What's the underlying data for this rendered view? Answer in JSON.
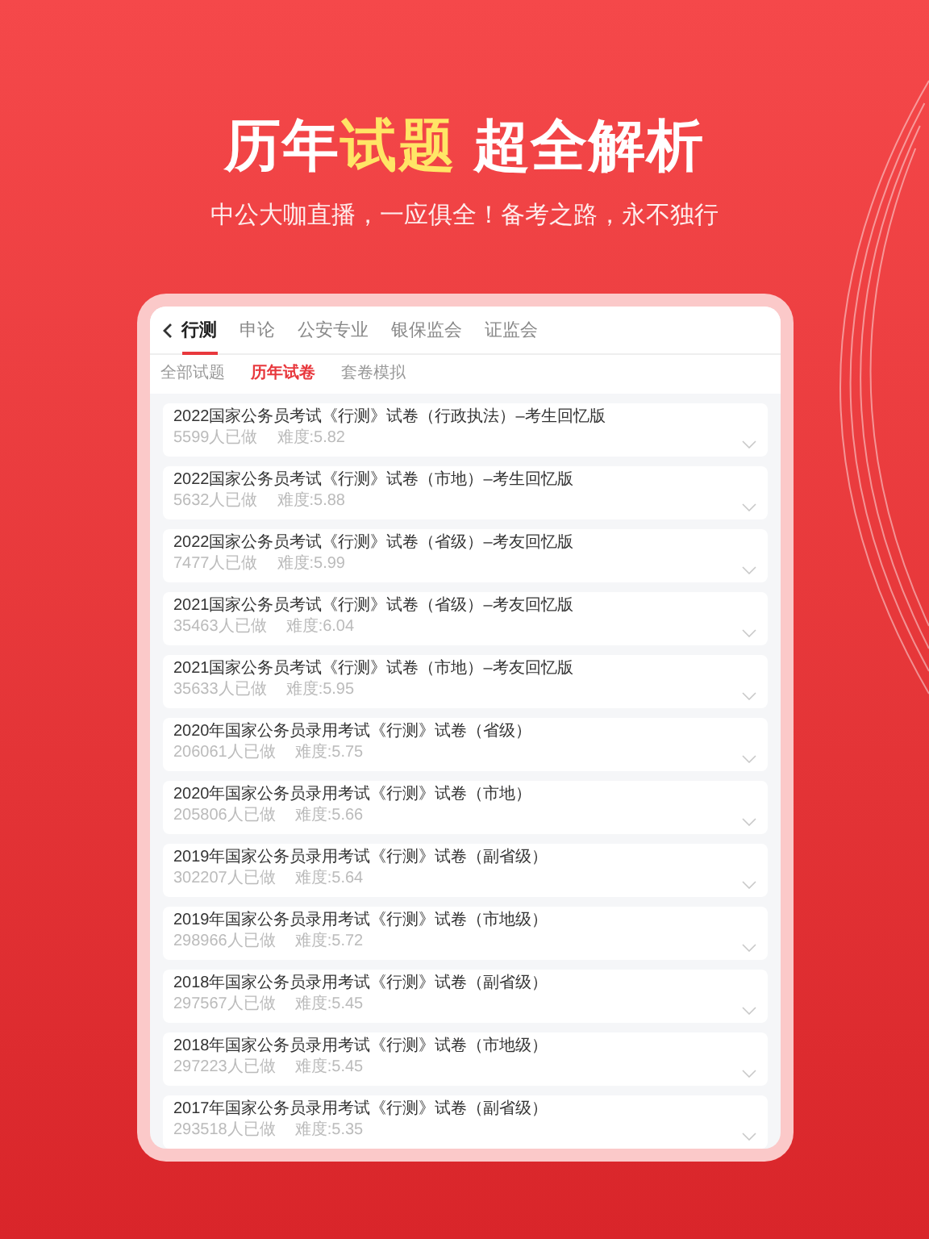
{
  "headline": [
    {
      "text": "历年",
      "highlight": false
    },
    {
      "text": "试题",
      "highlight": true
    },
    {
      "text": " 超全解析",
      "highlight": false
    }
  ],
  "subtitle": "中公大咖直播，一应俱全！备考之路，永不独行",
  "tabs": [
    {
      "label": "行测",
      "selected": true
    },
    {
      "label": "申论",
      "selected": false
    },
    {
      "label": "公安专业",
      "selected": false
    },
    {
      "label": "银保监会",
      "selected": false
    },
    {
      "label": "证监会",
      "selected": false
    }
  ],
  "subtabs": [
    {
      "label": "全部试题",
      "selected": false
    },
    {
      "label": "历年试卷",
      "selected": true
    },
    {
      "label": "套卷模拟",
      "selected": false
    }
  ],
  "papers": [
    {
      "title": "2022国家公务员考试《行测》试卷（行政执法）–考生回忆版",
      "done": "5599人已做",
      "difficulty": "难度:5.82"
    },
    {
      "title": "2022国家公务员考试《行测》试卷（市地）–考生回忆版",
      "done": "5632人已做",
      "difficulty": "难度:5.88"
    },
    {
      "title": "2022国家公务员考试《行测》试卷（省级）–考友回忆版",
      "done": "7477人已做",
      "difficulty": "难度:5.99"
    },
    {
      "title": "2021国家公务员考试《行测》试卷（省级）–考友回忆版",
      "done": "35463人已做",
      "difficulty": "难度:6.04"
    },
    {
      "title": "2021国家公务员考试《行测》试卷（市地）–考友回忆版",
      "done": "35633人已做",
      "difficulty": "难度:5.95"
    },
    {
      "title": "2020年国家公务员录用考试《行测》试卷（省级）",
      "done": "206061人已做",
      "difficulty": "难度:5.75"
    },
    {
      "title": "2020年国家公务员录用考试《行测》试卷（市地）",
      "done": "205806人已做",
      "difficulty": "难度:5.66"
    },
    {
      "title": "2019年国家公务员录用考试《行测》试卷（副省级）",
      "done": "302207人已做",
      "difficulty": "难度:5.64"
    },
    {
      "title": "2019年国家公务员录用考试《行测》试卷（市地级）",
      "done": "298966人已做",
      "difficulty": "难度:5.72"
    },
    {
      "title": "2018年国家公务员录用考试《行测》试卷（副省级）",
      "done": "297567人已做",
      "difficulty": "难度:5.45"
    },
    {
      "title": "2018年国家公务员录用考试《行测》试卷（市地级）",
      "done": "297223人已做",
      "difficulty": "难度:5.45"
    },
    {
      "title": "2017年国家公务员录用考试《行测》试卷（副省级）",
      "done": "293518人已做",
      "difficulty": "难度:5.35"
    }
  ]
}
